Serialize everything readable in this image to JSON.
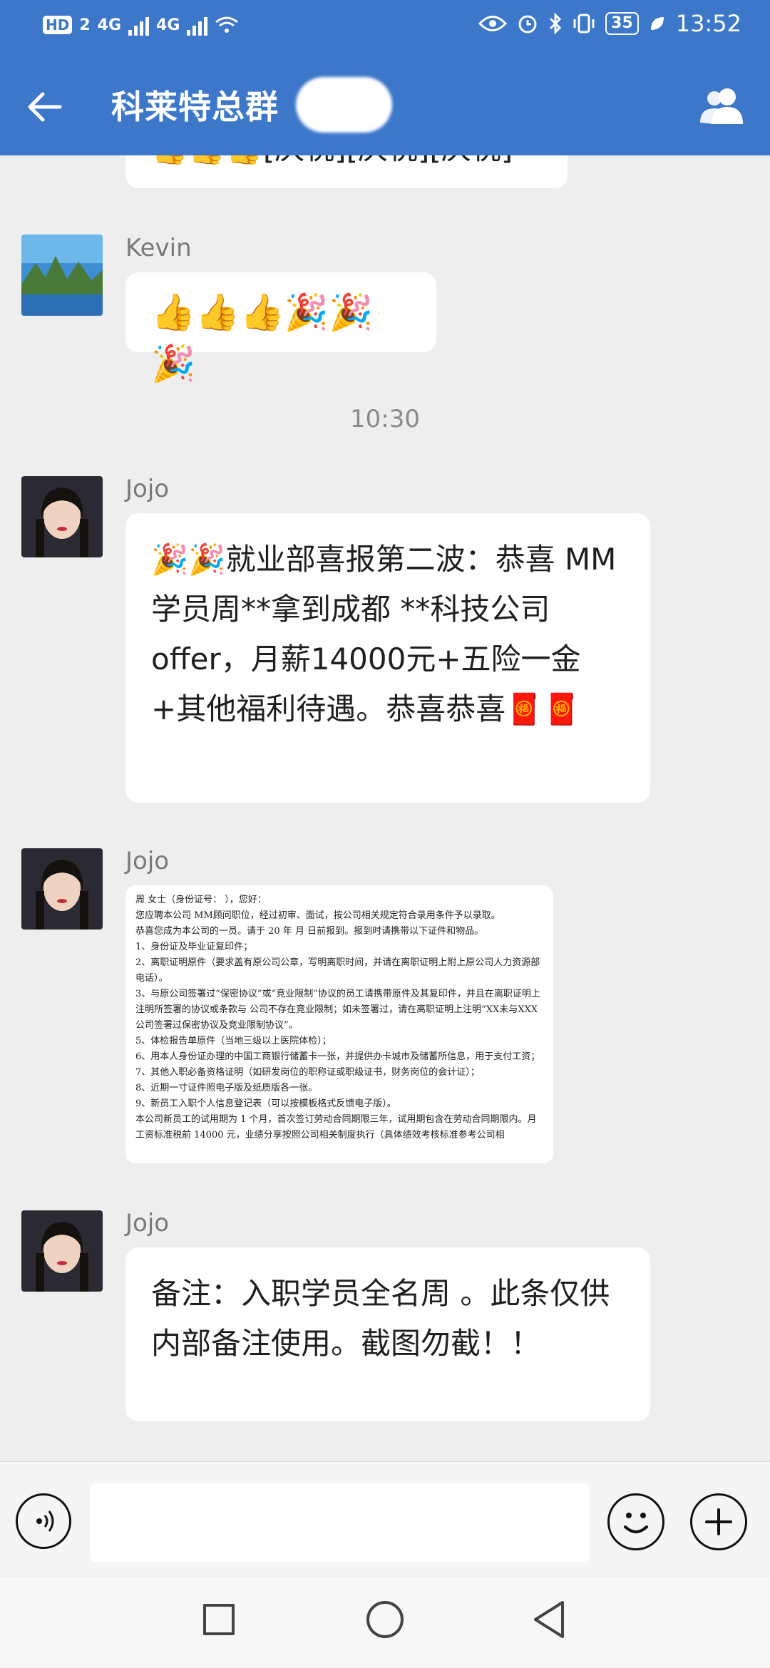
{
  "status": {
    "hd": "HD",
    "sim": "2",
    "net1": "4G",
    "net2": "4G",
    "battery": "35",
    "time": "13:52"
  },
  "header": {
    "title": "科莱特总群"
  },
  "messages": [
    {
      "type": "text",
      "sender": "",
      "content": "👍👍👍[庆祝][庆祝][庆祝]"
    },
    {
      "type": "text",
      "sender": "Kevin",
      "content": "👍👍👍🎉🎉🎉"
    },
    {
      "type": "time",
      "content": "10:30"
    },
    {
      "type": "text",
      "sender": "Jojo",
      "content": "🎉🎉就业部喜报第二波：恭喜 MM学员周**拿到成都 **科技公司offer，月薪14000元+五险一金+其他福利待遇。恭喜恭喜🧧🧧"
    },
    {
      "type": "image",
      "sender": "Jojo",
      "doc": {
        "line1": "周 女士（身份证号： ），您好：",
        "line2": "您应聘本公司 MM顾问职位，经过初审、面试，按公司相关规定符合录用条件予以录取。",
        "line3": "恭喜您成为本公司的一员。请于 20 年 月 日前报到。报到时请携带以下证件和物品。",
        "line4": "1、身份证及毕业证复印件；",
        "line5": "2、离职证明原件（要求盖有原公司公章，写明离职时间，并请在离职证明上附上原公司人力资源部电话）。",
        "line6": "3、与原公司签署过“保密协议”或“竞业限制”协议的员工请携带原件及其复印件，并且在离职证明上注明所签署的协议或条款与 公司不存在竞业限制；如未签署过，请在离职证明上注明“XX未与XXX公司签署过保密协议及竞业限制协议”。",
        "line7": "5、体检报告单原件（当地三级以上医院体检）；",
        "line8": "6、用本人身份证办理的中国工商银行储蓄卡一张，并提供办卡城市及储蓄所信息，用于支付工资；",
        "line9": "7、其他入职必备资格证明（如研发岗位的职称证或职级证书，财务岗位的会计证）；",
        "line10": "8、近期一寸证件照电子版及纸质版各一张。",
        "line11": "9、新员工入职个人信息登记表（可以按模板格式反馈电子版）。",
        "line12": "本公司新员工的试用期为 1 个月，首次签订劳动合同期限三年，试用期包含在劳动合同期限内。月工资标准税前 14000 元，业绩分享按照公司相关制度执行（具体绩效考核标准参考公司相",
        "salary": "14000"
      }
    },
    {
      "type": "text",
      "sender": "Jojo",
      "content": "备注：入职学员全名周 。此条仅供内部备注使用。截图勿截！！"
    }
  ],
  "input": {
    "placeholder": ""
  }
}
